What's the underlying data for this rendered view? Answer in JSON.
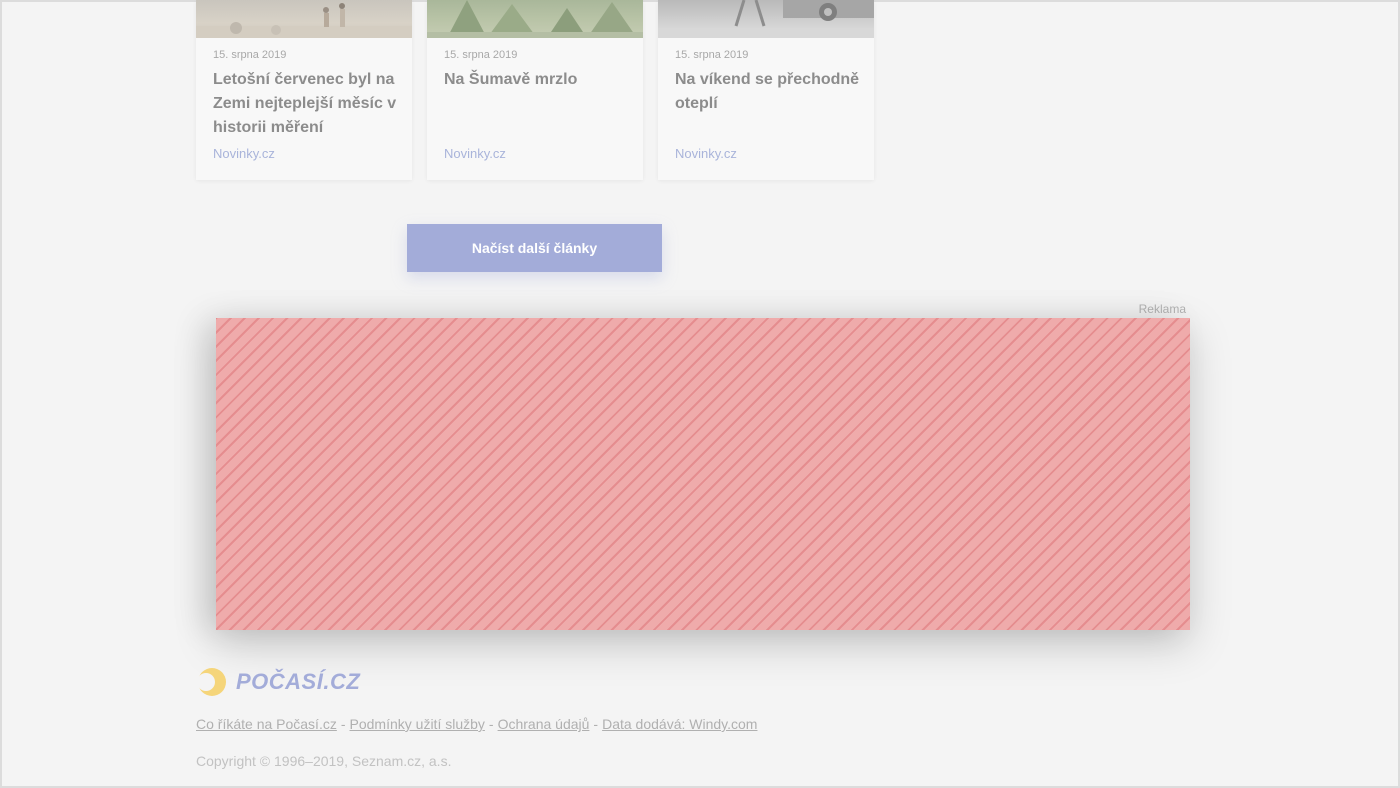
{
  "articles": [
    {
      "date": "15. srpna 2019",
      "title": "Letošní červenec byl na Zemi nejteplejší měsíc v historii měření",
      "source": "Novinky.cz"
    },
    {
      "date": "15. srpna 2019",
      "title": "Na Šumavě mrzlo",
      "source": "Novinky.cz"
    },
    {
      "date": "15. srpna 2019",
      "title": "Na víkend se přechodně oteplí",
      "source": "Novinky.cz"
    }
  ],
  "load_more": {
    "label": "Načíst další články"
  },
  "ad": {
    "label": "Reklama"
  },
  "footer": {
    "logo_text": "POČASÍ.CZ",
    "links": [
      "Co říkáte na Počasí.cz",
      "Podmínky užití služby",
      "Ochrana údajů",
      "Data dodává: Windy.com"
    ],
    "separator": "-",
    "copyright": "Copyright © 1996–2019, Seznam.cz, a.s."
  },
  "colors": {
    "accent": "#a3acd9",
    "ad_fill": "#efabab",
    "ad_stripe": "#e58d8f",
    "logo_sun": "#f5d57a"
  }
}
